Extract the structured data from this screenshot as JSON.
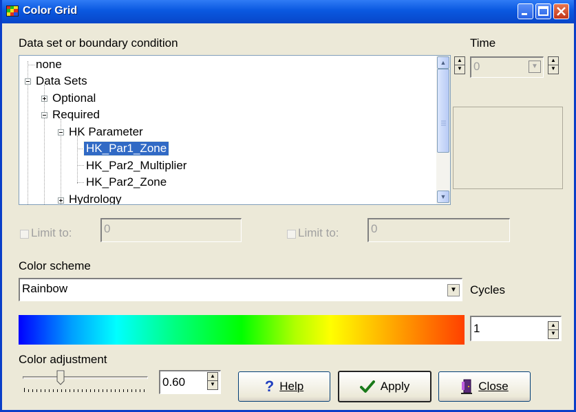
{
  "window": {
    "title": "Color Grid",
    "colors": {
      "titlebar": "#0a58e0",
      "face": "#ece9d8",
      "selection": "#316ac5"
    }
  },
  "labels": {
    "dataset": "Data set or boundary condition",
    "time": "Time",
    "limit_min": "Limit to:",
    "limit_max": "Limit to:",
    "color_scheme": "Color scheme",
    "cycles": "Cycles",
    "color_adjustment": "Color adjustment"
  },
  "tree": {
    "items": [
      {
        "label": "none",
        "level": 0,
        "expander": "none"
      },
      {
        "label": "Data Sets",
        "level": 0,
        "expander": "minus"
      },
      {
        "label": "Optional",
        "level": 1,
        "expander": "plus"
      },
      {
        "label": "Required",
        "level": 1,
        "expander": "minus"
      },
      {
        "label": "HK Parameter",
        "level": 2,
        "expander": "minus"
      },
      {
        "label": "HK_Par1_Zone",
        "level": 3,
        "expander": "none",
        "selected": true
      },
      {
        "label": "HK_Par2_Multiplier",
        "level": 3,
        "expander": "none"
      },
      {
        "label": "HK_Par2_Zone",
        "level": 3,
        "expander": "none"
      },
      {
        "label": "Hydrology",
        "level": 2,
        "expander": "plus"
      }
    ]
  },
  "time": {
    "value": "0"
  },
  "limits": {
    "min_value": "0",
    "max_value": "0",
    "min_checked": false,
    "max_checked": false
  },
  "color_scheme": {
    "selected": "Rainbow"
  },
  "cycles": {
    "value": "1"
  },
  "adjustment": {
    "value": "0.60",
    "slider_fraction": 0.3
  },
  "buttons": {
    "help": "Help",
    "apply": "Apply",
    "close": "Close"
  },
  "icons": {
    "app": "color-grid-app-icon",
    "help": "question-mark-icon",
    "apply": "checkmark-icon",
    "close": "exit-door-icon"
  }
}
